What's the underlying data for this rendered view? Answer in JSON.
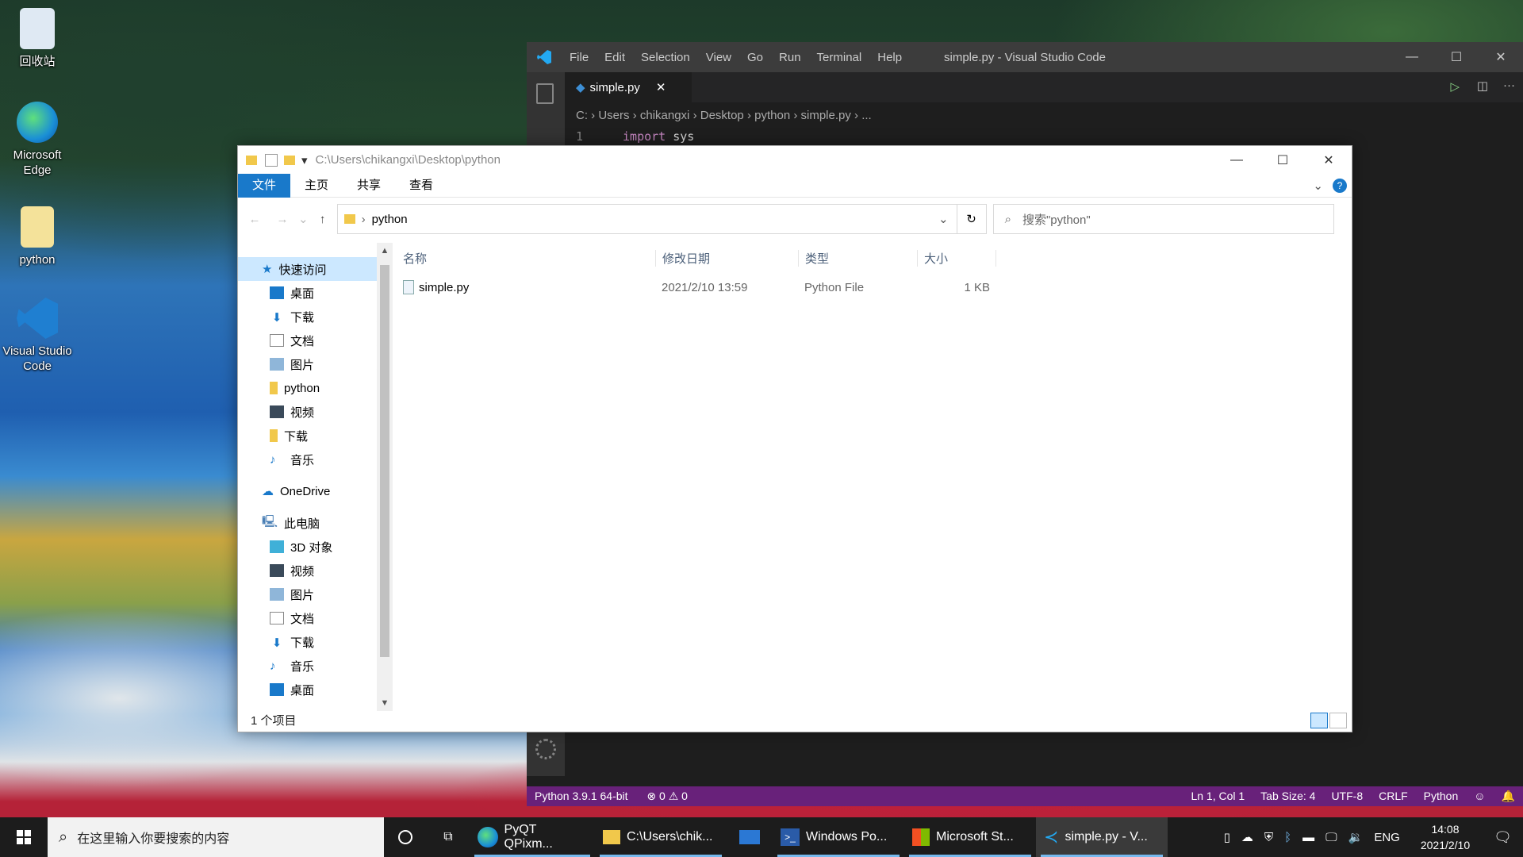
{
  "desktop": {
    "icons": [
      {
        "label": "回收站",
        "color": "#dfe9f3"
      },
      {
        "label": "Microsoft Edge",
        "color": "#1a8fd6"
      },
      {
        "label": "python",
        "color": "#f4e29a"
      },
      {
        "label": "Visual Studio Code",
        "color": "#1f7fd1"
      }
    ]
  },
  "vscode": {
    "title": "simple.py - Visual Studio Code",
    "menu": [
      "File",
      "Edit",
      "Selection",
      "View",
      "Go",
      "Run",
      "Terminal",
      "Help"
    ],
    "tab": "simple.py",
    "breadcrumb": [
      "C:",
      "Users",
      "chikangxi",
      "Desktop",
      "python",
      "simple.py",
      "..."
    ],
    "line_no": "1",
    "code_kw": "import",
    "code_rest": "sys",
    "status_left": [
      "Python 3.9.1 64-bit",
      "⊗ 0 ⚠ 0"
    ],
    "status_right": [
      "Ln 1, Col 1",
      "Tab Size: 4",
      "UTF-8",
      "CRLF",
      "Python"
    ]
  },
  "explorer": {
    "title_path": "C:\\Users\\chikangxi\\Desktop\\python",
    "ribbon_tabs": [
      "文件",
      "主页",
      "共享",
      "查看"
    ],
    "address": "python",
    "search_placeholder": "搜索\"python\"",
    "quick_access": "快速访问",
    "quick_items": [
      "桌面",
      "下载",
      "文档",
      "图片",
      "python",
      "视频",
      "下载",
      "音乐"
    ],
    "onedrive": "OneDrive",
    "this_pc": "此电脑",
    "pc_items": [
      "3D 对象",
      "视频",
      "图片",
      "文档",
      "下载",
      "音乐",
      "桌面"
    ],
    "columns": [
      "名称",
      "修改日期",
      "类型",
      "大小"
    ],
    "files": [
      {
        "name": "simple.py",
        "date": "2021/2/10 13:59",
        "type": "Python File",
        "size": "1 KB"
      }
    ],
    "status": "1 个项目"
  },
  "taskbar": {
    "search": "在这里输入你要搜索的内容",
    "apps": [
      {
        "label": "PyQT QPixm...",
        "open": true
      },
      {
        "label": "C:\\Users\\chik...",
        "open": true
      },
      {
        "label": "",
        "open": false
      },
      {
        "label": "Windows Po...",
        "open": true
      },
      {
        "label": "Microsoft St...",
        "open": true
      },
      {
        "label": "simple.py - V...",
        "open": true
      }
    ],
    "lang": "ENG",
    "time": "14:08",
    "date": "2021/2/10"
  }
}
